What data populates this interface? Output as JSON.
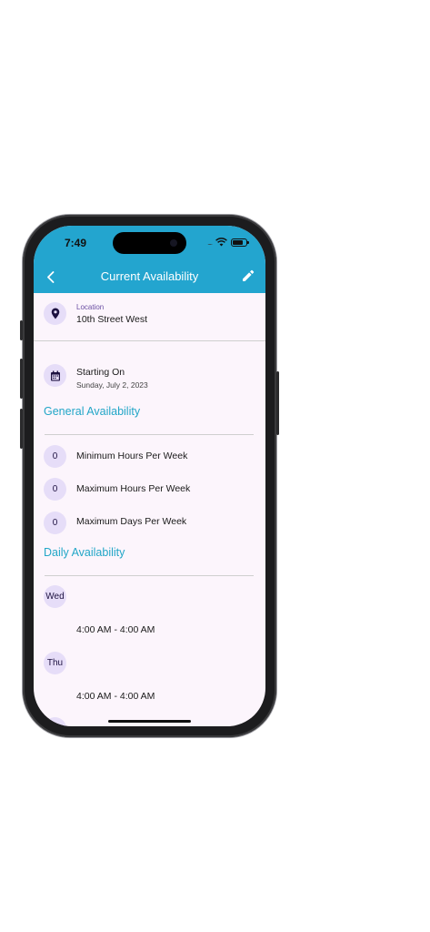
{
  "status_bar": {
    "time": "7:49",
    "signal": "....",
    "wifi_icon": "wifi-icon",
    "battery_icon": "battery-icon"
  },
  "header": {
    "title": "Current Availability",
    "back_icon": "chevron-left-icon",
    "edit_icon": "pencil-icon",
    "color": "#23a5cf"
  },
  "location": {
    "label": "Location",
    "value": "10th Street West",
    "icon": "location-pin-icon"
  },
  "starting": {
    "label": "Starting On",
    "date": "Sunday, July 2, 2023",
    "icon": "calendar-icon"
  },
  "general": {
    "title": "General Availability",
    "items": [
      {
        "value": "0",
        "label": "Minimum Hours Per Week"
      },
      {
        "value": "0",
        "label": "Maximum Hours Per Week"
      },
      {
        "value": "0",
        "label": "Maximum Days Per Week"
      }
    ]
  },
  "daily": {
    "title": "Daily Availability",
    "days": [
      {
        "day": "Wed",
        "time": "4:00 AM - 4:00 AM"
      },
      {
        "day": "Thu",
        "time": "4:00 AM - 4:00 AM"
      }
    ]
  },
  "colors": {
    "accent": "#22a6c7",
    "circle_bg": "#e6ddf8",
    "background": "#fcf5fc"
  }
}
